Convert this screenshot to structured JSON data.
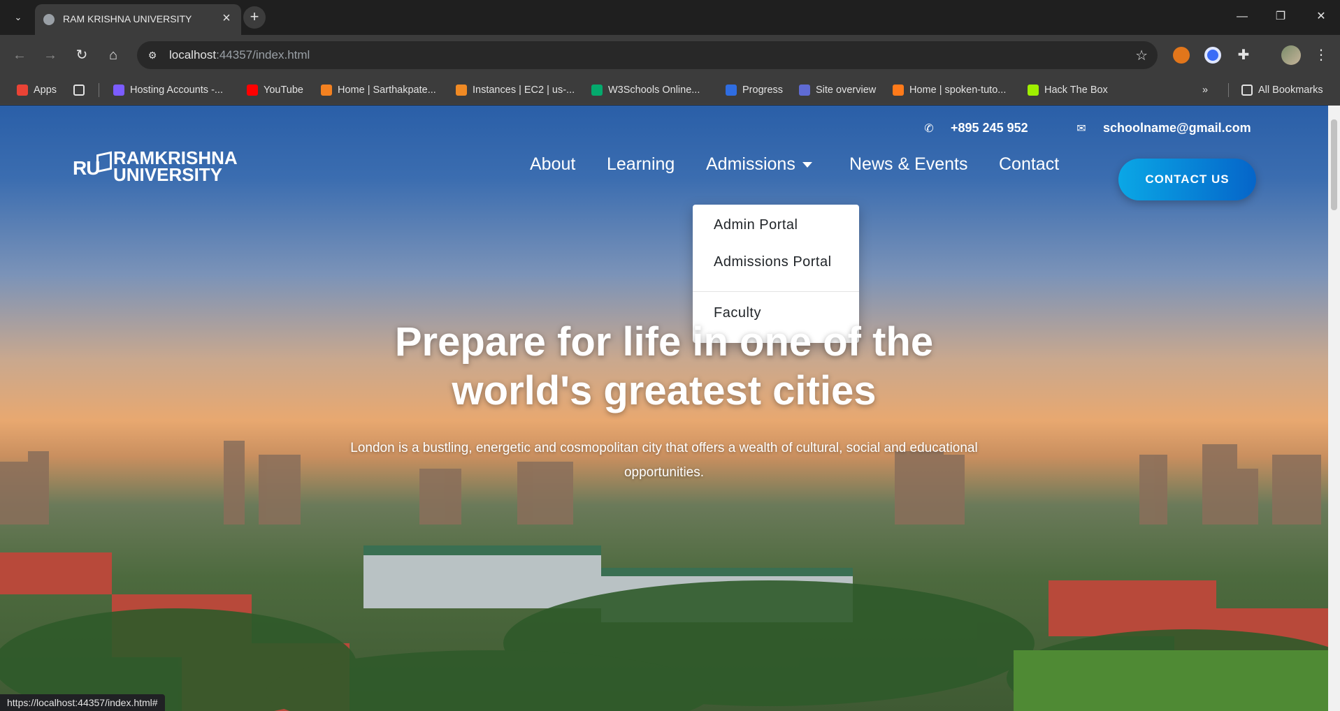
{
  "browser": {
    "tab_title": "RAM KRISHNA UNIVERSITY",
    "url_host": "localhost",
    "url_rest": ":44357/index.html",
    "status_url": "https://localhost:44357/index.html#"
  },
  "bookmarks": [
    {
      "label": "Apps",
      "color": "#ea4335"
    },
    {
      "label": "Hosting Accounts -...",
      "color": "#7b5cff"
    },
    {
      "label": "YouTube",
      "color": "#ff0000"
    },
    {
      "label": "Home | Sarthakpate...",
      "color": "#f48120"
    },
    {
      "label": "Instances | EC2 | us-...",
      "color": "#f08a24"
    },
    {
      "label": "W3Schools Online...",
      "color": "#04aa6d"
    },
    {
      "label": "Progress",
      "color": "#2f6de1"
    },
    {
      "label": "Site overview",
      "color": "#5f6bd4"
    },
    {
      "label": "Home | spoken-tuto...",
      "color": "#ff7a1a"
    },
    {
      "label": "Hack The Box",
      "color": "#9fef00"
    },
    {
      "label": "All Bookmarks",
      "color": "#e3e3e3"
    }
  ],
  "topbar": {
    "phone": "+895 245 952",
    "email": "schoolname@gmail.com"
  },
  "logo": {
    "ru": "RU",
    "line1": "RAMKRISHNA",
    "line2": "UNIVERSITY"
  },
  "nav": {
    "about": "About",
    "learning": "Learning",
    "admissions": "Admissions",
    "news": "News & Events",
    "contact": "Contact",
    "cta": "CONTACT US"
  },
  "dropdown": {
    "items": [
      "Admin Portal",
      "Admissions Portal",
      "Faculty"
    ]
  },
  "hero": {
    "title_line1": "Prepare for life in one of the",
    "title_line2": "world's greatest cities",
    "subtitle": "London is a bustling, energetic and cosmopolitan city that offers a wealth of cultural, social and educational opportunities."
  },
  "colors": {
    "accent_start": "#0aa7e6",
    "accent_end": "#0565c9"
  }
}
